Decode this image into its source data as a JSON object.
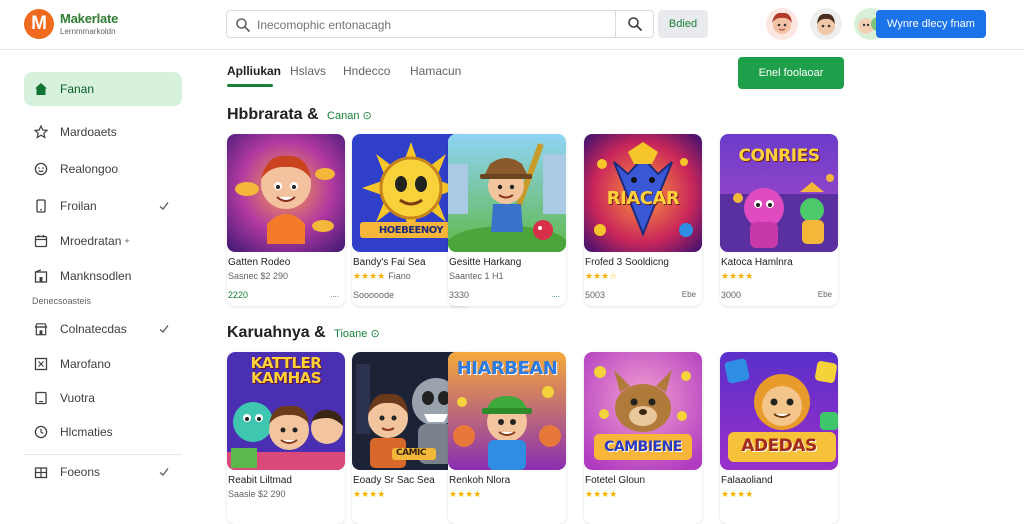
{
  "header": {
    "logo_letter": "M",
    "app_name": "Makerlate",
    "app_tagline": "Lernmmarkoldn",
    "search_placeholder": "Inecomophic entonacagh",
    "filter_label": "Bdied",
    "cta_label": "Wynre dlecy fnam"
  },
  "sidebar": {
    "items": [
      {
        "label": "Fanan",
        "icon": "home-icon",
        "active": true
      },
      {
        "label": "Mardoaets",
        "icon": "star-icon"
      },
      {
        "label": "Realongoo",
        "icon": "smile-icon"
      },
      {
        "label": "Froilan",
        "icon": "phone-icon",
        "check": true
      },
      {
        "label": "Mroedratan",
        "icon": "calendar-icon",
        "suffix": "+"
      },
      {
        "label": "Manknsodlen",
        "icon": "building-icon"
      }
    ],
    "section_label": "Denecsoasteis",
    "items2": [
      {
        "label": "Colnatecdas",
        "icon": "store-icon",
        "check": true
      },
      {
        "label": "Marofano",
        "icon": "close-box-icon"
      },
      {
        "label": "Vuotra",
        "icon": "tablet-icon"
      },
      {
        "label": "Hlcmaties",
        "icon": "clock-icon"
      }
    ],
    "items3": [
      {
        "label": "Foeons",
        "icon": "grid-icon",
        "check": true
      }
    ]
  },
  "tabs": [
    {
      "label": "Aplliukan",
      "active": true
    },
    {
      "label": "Hslavs"
    },
    {
      "label": "Hndecco"
    },
    {
      "label": "Hamacun"
    }
  ],
  "primary_button": "Enel foolaoar",
  "sections": [
    {
      "title": "Hbbrarata &",
      "link": "Canan",
      "cards": [
        {
          "title": "Gatten Rodeo",
          "sub": "Sasnec $2 290",
          "price": "2220",
          "meta": "....",
          "art": "art-1",
          "stars": ""
        },
        {
          "title": "Bandy's Fai Sea",
          "sub": "Fiano",
          "price": "Sooooode",
          "meta": "",
          "art": "art-2",
          "stars": "★★★★",
          "art_text": "HOEBEENOY"
        },
        {
          "title": "Gesitte Harkang",
          "sub": "Saantec 1 H1",
          "price": "3330",
          "meta": "....",
          "art": "art-3",
          "stars": ""
        },
        {
          "title": "Frofed 3 Sooldicng",
          "sub": "",
          "price": "5003",
          "meta": "Ebe",
          "art": "art-4",
          "stars": "★★★☆",
          "art_text": "RIACAR"
        },
        {
          "title": "Katoca Hamlnra",
          "sub": "",
          "price": "3000",
          "meta": "Ebe",
          "art": "art-5",
          "stars": "★★★★",
          "art_text": "CONRIES"
        }
      ]
    },
    {
      "title": "Karuahnya &",
      "link": "Tioane",
      "cards": [
        {
          "title": "Reabit Liltmad",
          "sub": "Saasle $2 290",
          "price": "",
          "meta": "",
          "art": "art-6",
          "stars": "",
          "art_text": "KATTLER KAMHAS"
        },
        {
          "title": "Eoady Sr Sac Sea",
          "sub": "",
          "price": "",
          "meta": "",
          "art": "art-7",
          "stars": "★★★★",
          "art_text": "CAMIC"
        },
        {
          "title": "Renkoh Nlora",
          "sub": "",
          "price": "",
          "meta": "",
          "art": "art-8",
          "stars": "★★★★",
          "art_text": "HIARBEAN"
        },
        {
          "title": "Fotetel Gloun",
          "sub": "",
          "price": "",
          "meta": "",
          "art": "art-9",
          "stars": "★★★★",
          "art_text": "CAMBIENE"
        },
        {
          "title": "Falaaoliand",
          "sub": "",
          "price": "",
          "meta": "",
          "art": "art-10",
          "stars": "★★★★",
          "art_text": "ADEDAS"
        }
      ]
    }
  ],
  "colors": {
    "accent_green": "#1ea04b",
    "brand_orange": "#f06a1d",
    "cta_blue": "#1a73e8",
    "star_yellow": "#f4b400"
  }
}
